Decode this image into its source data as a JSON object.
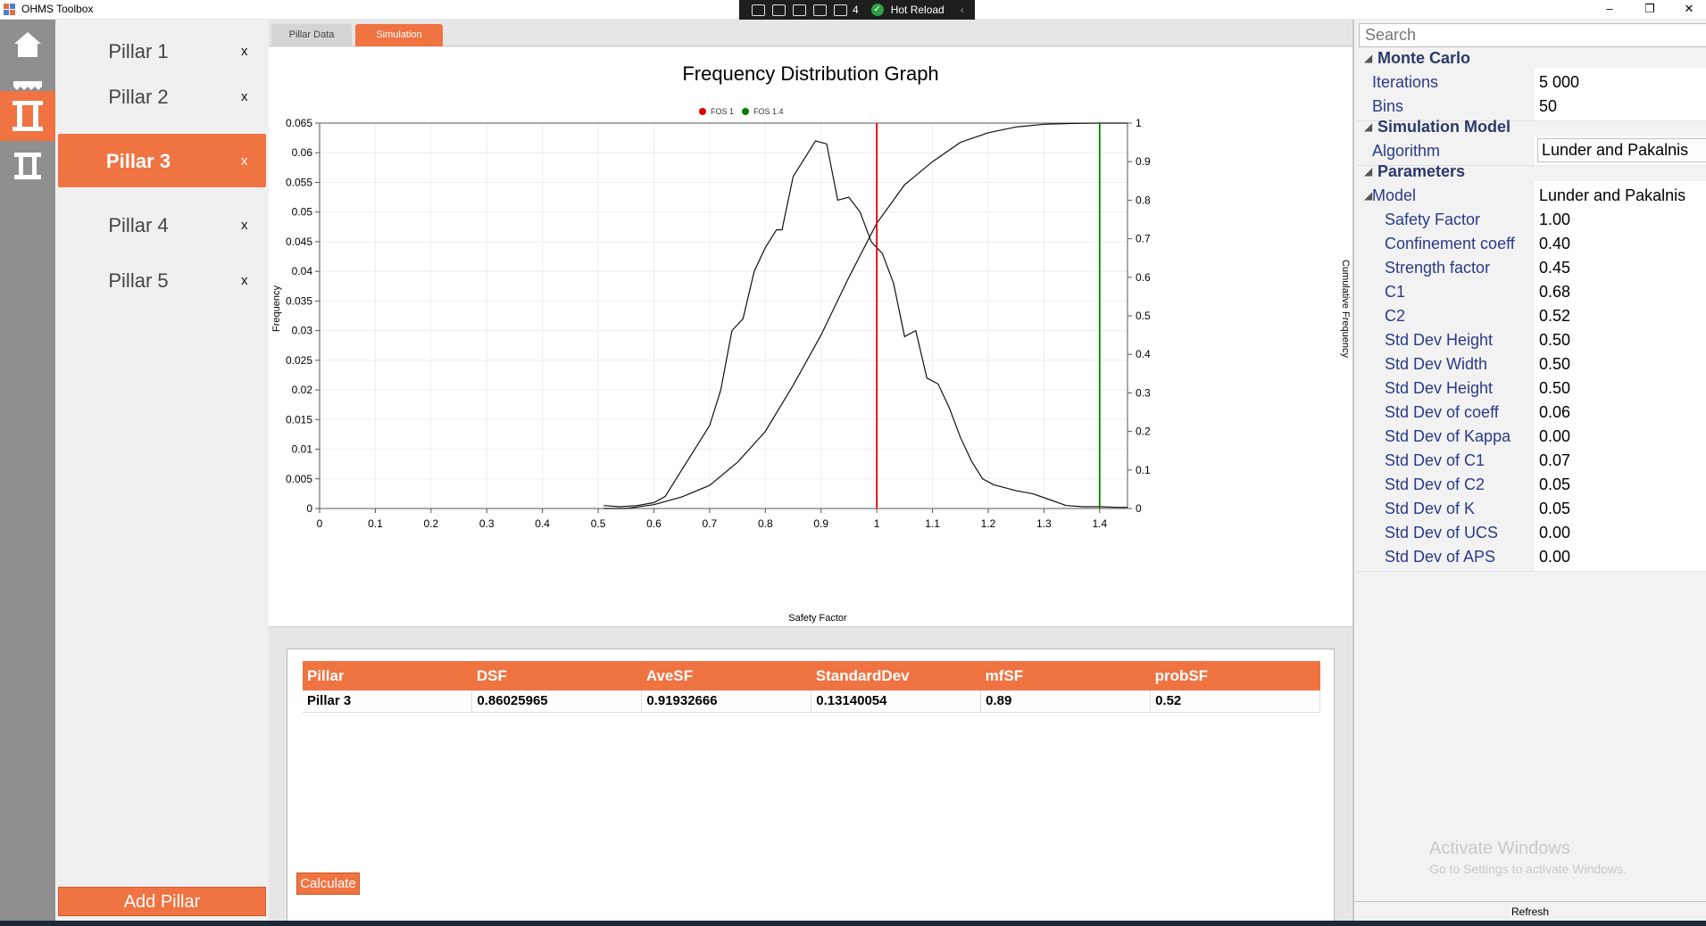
{
  "app": {
    "title": "OHMS Toolbox",
    "hot_reload": {
      "count": "4",
      "label": "Hot Reload"
    }
  },
  "pillars": {
    "items": [
      {
        "label": "Pillar 1",
        "close": "x"
      },
      {
        "label": "Pillar 2",
        "close": "x"
      },
      {
        "label": "Pillar 3",
        "close": "x",
        "active": true
      },
      {
        "label": "Pillar 4",
        "close": "x"
      },
      {
        "label": "Pillar 5",
        "close": "x"
      }
    ],
    "add_label": "Add Pillar"
  },
  "tabs": {
    "pillar_data": "Pillar Data",
    "simulation": "Simulation",
    "active": "simulation"
  },
  "theme": {
    "accent": "#f07342",
    "fos1_color": "#e00000",
    "fos14_color": "#008000"
  },
  "chart_data": {
    "type": "line",
    "title": "Frequency Distribution Graph",
    "xlabel": "Safety Factor",
    "ylabel": "Frequency",
    "y2label": "Cumulative Frequency",
    "xlim": [
      0,
      1.45
    ],
    "ylim": [
      0,
      0.065
    ],
    "y2lim": [
      0,
      1
    ],
    "xticks": [
      0,
      0.1,
      0.2,
      0.3,
      0.4,
      0.5,
      0.6,
      0.7,
      0.8,
      0.9,
      1,
      1.1,
      1.2,
      1.3,
      1.4
    ],
    "yticks": [
      0,
      0.005,
      0.01,
      0.015,
      0.02,
      0.025,
      0.03,
      0.035,
      0.04,
      0.045,
      0.05,
      0.055,
      0.06,
      0.065
    ],
    "y2ticks": [
      0,
      0.1,
      0.2,
      0.3,
      0.4,
      0.5,
      0.6,
      0.7,
      0.8,
      0.9,
      1
    ],
    "legend": [
      {
        "name": "FOS 1",
        "color": "#e00000"
      },
      {
        "name": "FOS 1.4",
        "color": "#008000"
      }
    ],
    "vlines": [
      {
        "x": 1.0,
        "color": "#e00000"
      },
      {
        "x": 1.4,
        "color": "#008000"
      }
    ],
    "series": [
      {
        "name": "Frequency",
        "axis": "left",
        "x": [
          0.51,
          0.54,
          0.57,
          0.6,
          0.62,
          0.64,
          0.66,
          0.68,
          0.7,
          0.72,
          0.74,
          0.76,
          0.78,
          0.8,
          0.82,
          0.83,
          0.85,
          0.87,
          0.89,
          0.91,
          0.93,
          0.95,
          0.97,
          0.99,
          1.01,
          1.03,
          1.05,
          1.07,
          1.09,
          1.11,
          1.13,
          1.15,
          1.17,
          1.19,
          1.21,
          1.23,
          1.25,
          1.28,
          1.31,
          1.34,
          1.37,
          1.4,
          1.43,
          1.45
        ],
        "values": [
          0.0005,
          0.0003,
          0.0005,
          0.001,
          0.002,
          0.005,
          0.008,
          0.011,
          0.014,
          0.02,
          0.03,
          0.032,
          0.04,
          0.044,
          0.047,
          0.047,
          0.056,
          0.059,
          0.062,
          0.0615,
          0.052,
          0.0525,
          0.05,
          0.045,
          0.043,
          0.038,
          0.029,
          0.03,
          0.022,
          0.021,
          0.017,
          0.012,
          0.008,
          0.005,
          0.004,
          0.0035,
          0.003,
          0.0025,
          0.0015,
          0.0005,
          0.0003,
          0.0003,
          0.0002,
          0.0002
        ]
      },
      {
        "name": "Cumulative Frequency",
        "axis": "right",
        "x": [
          0.51,
          0.55,
          0.6,
          0.65,
          0.7,
          0.75,
          0.8,
          0.85,
          0.9,
          0.95,
          1.0,
          1.05,
          1.1,
          1.15,
          1.2,
          1.25,
          1.3,
          1.35,
          1.4,
          1.45
        ],
        "values": [
          0.0,
          0.0,
          0.01,
          0.03,
          0.06,
          0.12,
          0.2,
          0.32,
          0.45,
          0.6,
          0.74,
          0.84,
          0.9,
          0.95,
          0.975,
          0.99,
          0.997,
          0.999,
          1.0,
          1.0
        ]
      }
    ]
  },
  "results": {
    "headers": [
      "Pillar",
      "DSF",
      "AveSF",
      "StandardDev",
      "mfSF",
      "probSF"
    ],
    "rows": [
      [
        "Pillar 3",
        "0.86025965",
        "0.91932666",
        "0.13140054",
        "0.89",
        "0.52"
      ]
    ],
    "calculate_label": "Calculate"
  },
  "properties": {
    "search_placeholder": "Search",
    "rows": [
      {
        "kind": "category",
        "name": "Monte Carlo"
      },
      {
        "kind": "item",
        "name": "Iterations",
        "value": "5 000",
        "level": 1
      },
      {
        "kind": "item",
        "name": "Bins",
        "value": "50",
        "level": 1
      },
      {
        "kind": "category",
        "name": "Simulation Model"
      },
      {
        "kind": "item",
        "name": "Algorithm",
        "value": "Lunder and Pakalnis",
        "level": 1,
        "select": true
      },
      {
        "kind": "category",
        "name": "Parameters"
      },
      {
        "kind": "item",
        "name": "Model",
        "value": "Lunder and Pakalnis",
        "level": 1,
        "expander": true
      },
      {
        "kind": "item",
        "name": "Safety Factor",
        "value": "1.00",
        "level": 2
      },
      {
        "kind": "item",
        "name": "Confinement coeff",
        "value": "0.40",
        "level": 2
      },
      {
        "kind": "item",
        "name": "Strength factor",
        "value": "0.45",
        "level": 2
      },
      {
        "kind": "item",
        "name": "C1",
        "value": "0.68",
        "level": 2
      },
      {
        "kind": "item",
        "name": "C2",
        "value": "0.52",
        "level": 2
      },
      {
        "kind": "item",
        "name": "Std Dev Height",
        "value": "0.50",
        "level": 2
      },
      {
        "kind": "item",
        "name": "Std Dev Width",
        "value": "0.50",
        "level": 2
      },
      {
        "kind": "item",
        "name": "Std Dev Height",
        "value": "0.50",
        "level": 2
      },
      {
        "kind": "item",
        "name": "Std Dev of coeff",
        "value": "0.06",
        "level": 2
      },
      {
        "kind": "item",
        "name": "Std Dev of Kappa",
        "value": "0.00",
        "level": 2
      },
      {
        "kind": "item",
        "name": "Std Dev of C1",
        "value": "0.07",
        "level": 2
      },
      {
        "kind": "item",
        "name": "Std Dev of C2",
        "value": "0.05",
        "level": 2
      },
      {
        "kind": "item",
        "name": "Std Dev of K",
        "value": "0.05",
        "level": 2
      },
      {
        "kind": "item",
        "name": "Std Dev of UCS",
        "value": "0.00",
        "level": 2
      },
      {
        "kind": "item",
        "name": "Std Dev of APS",
        "value": "0.00",
        "level": 2
      }
    ],
    "refresh_label": "Refresh"
  },
  "watermark": {
    "title": "Activate Windows",
    "subtitle": "Go to Settings to activate Windows."
  }
}
